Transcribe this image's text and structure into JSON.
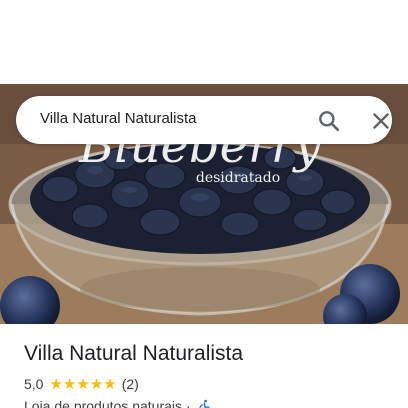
{
  "search": {
    "query": "Villa Natural Naturalista"
  },
  "hero": {
    "overlay_script": "Blueberry",
    "overlay_subtitle": "desidratado"
  },
  "place": {
    "name": "Villa Natural Naturalista",
    "rating": "5,0",
    "stars": "★★★★★",
    "star_count": 5,
    "review_count": "(2)",
    "category": "Loja de produtos naturais ·",
    "accessibility_icon": "wheelchair-icon"
  },
  "colors": {
    "star": "#fbbc04",
    "text_primary": "#202124",
    "text_secondary": "#3c4043"
  }
}
